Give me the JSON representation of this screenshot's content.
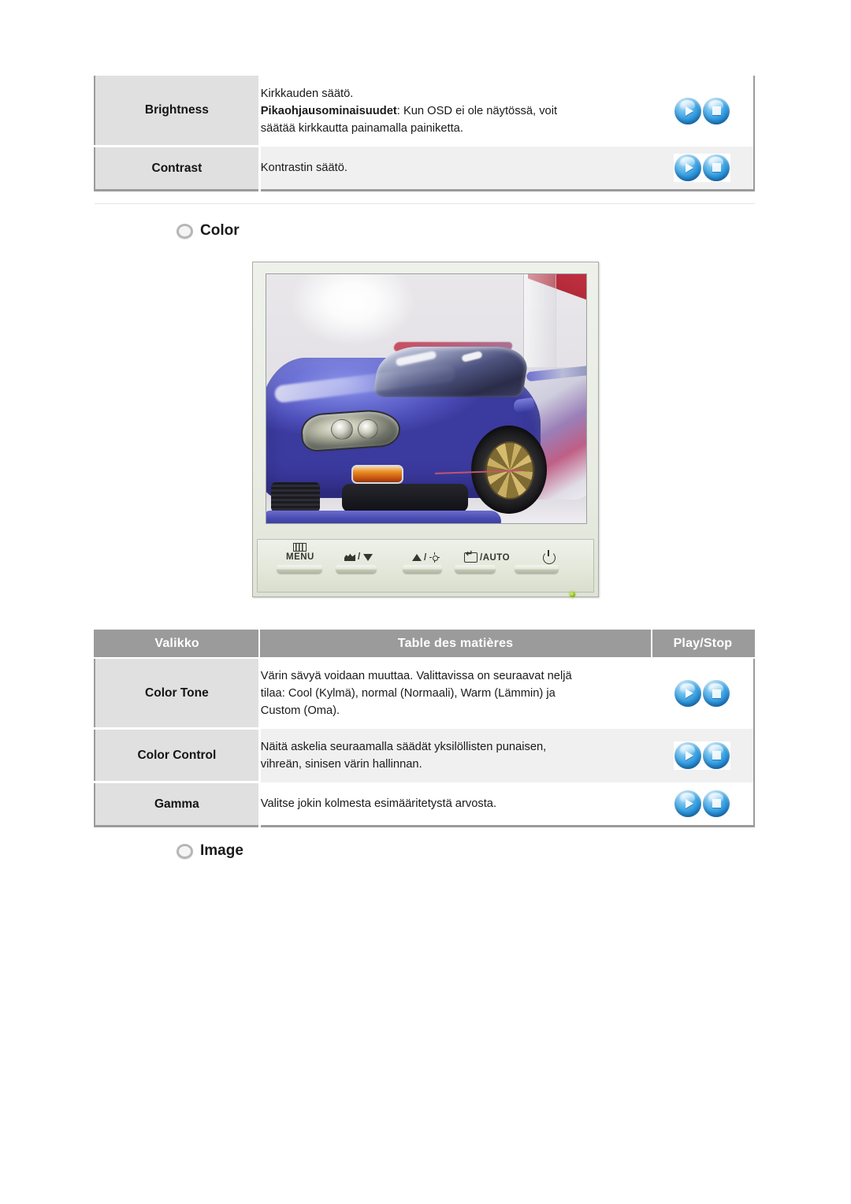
{
  "top_table": {
    "rows": [
      {
        "menu": "Brightness",
        "desc_line1": "Kirkkauden säätö.",
        "desc_bold": "Pikaohjausominaisuudet",
        "desc_line2": ": Kun OSD ei ole näytössä, voit",
        "desc_line3": "säätää kirkkautta painamalla painiketta.",
        "play": "play-icon",
        "stop": "stop-icon"
      },
      {
        "menu": "Contrast",
        "desc_line1": "Kontrastin säätö.",
        "desc_bold": "",
        "desc_line2": "",
        "desc_line3": "",
        "play": "play-icon",
        "stop": "stop-icon"
      }
    ]
  },
  "section_color": {
    "label": "Color",
    "bullet": "ring-bullet-icon"
  },
  "section_image": {
    "label": "Image",
    "bullet": "ring-bullet-icon"
  },
  "monitor": {
    "photo_alt": "blue sports car front view on showroom floor",
    "osd": {
      "menu_label": "MENU",
      "source_label": "/",
      "brightness_label": "/",
      "auto_label": "/AUTO",
      "power_label": "",
      "led": "power-led-green"
    }
  },
  "bottom_table": {
    "headers": [
      "Valikko",
      "Table des matières",
      "Play/Stop"
    ],
    "rows": [
      {
        "menu": "Color Tone",
        "desc_line1": "Värin sävyä voidaan muuttaa. Valittavissa on seuraavat neljä",
        "desc_line2": "tilaa: Cool (Kylmä), normal (Normaali), Warm (Lämmin) ja",
        "desc_line3": "Custom (Oma).",
        "play": "play-icon",
        "stop": "stop-icon"
      },
      {
        "menu": "Color Control",
        "desc_line1": "Näitä askelia seuraamalla säädät yksilöllisten punaisen,",
        "desc_line2": "vihreän, sinisen värin hallinnan.",
        "desc_line3": "",
        "play": "play-icon",
        "stop": "stop-icon"
      },
      {
        "menu": "Gamma",
        "desc_line1": "Valitse jokin kolmesta esimääritetystä arvosta.",
        "desc_line2": "",
        "desc_line3": "",
        "play": "play-icon",
        "stop": "stop-icon"
      }
    ]
  },
  "colors": {
    "header_gray": "#9b9b9b",
    "cell_gray": "#e0e0e0",
    "tint_gray": "#f0f0f0",
    "button_blue": "#2f9ade",
    "led_green": "#9cc72a"
  }
}
